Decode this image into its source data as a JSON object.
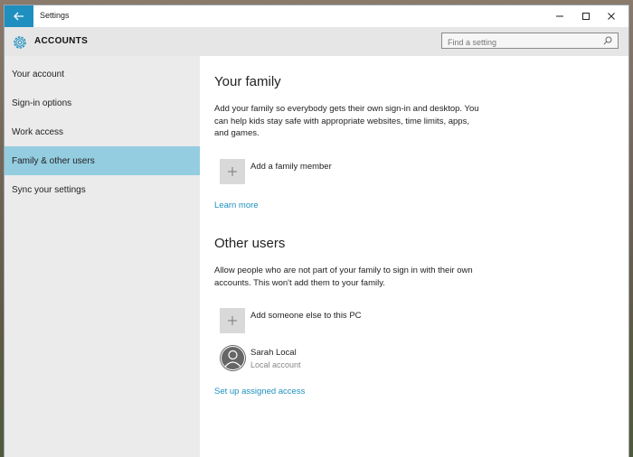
{
  "window": {
    "title": "Settings"
  },
  "header": {
    "section": "ACCOUNTS",
    "search_placeholder": "Find a setting"
  },
  "sidebar": {
    "items": [
      {
        "label": "Your account"
      },
      {
        "label": "Sign-in options"
      },
      {
        "label": "Work access"
      },
      {
        "label": "Family & other users",
        "active": true
      },
      {
        "label": "Sync your settings"
      }
    ]
  },
  "family": {
    "heading": "Your family",
    "description": "Add your family so everybody gets their own sign-in and desktop. You can help kids stay safe with appropriate websites, time limits, apps, and games.",
    "add_label": "Add a family member",
    "learn_more": "Learn more"
  },
  "others": {
    "heading": "Other users",
    "description": "Allow people who are not part of your family to sign in with their own accounts. This won't add them to your family.",
    "add_label": "Add someone else to this PC",
    "user_name": "Sarah Local",
    "user_type": "Local account",
    "assigned_access": "Set up assigned access"
  },
  "colors": {
    "accent": "#1f8fbf",
    "selected": "#94cde0",
    "sidebar_bg": "#ebebeb",
    "header_bg": "#e6e6e6"
  },
  "icons": {
    "back": "arrow-left",
    "gear": "gear",
    "search": "magnifier",
    "add": "plus",
    "user": "person"
  }
}
